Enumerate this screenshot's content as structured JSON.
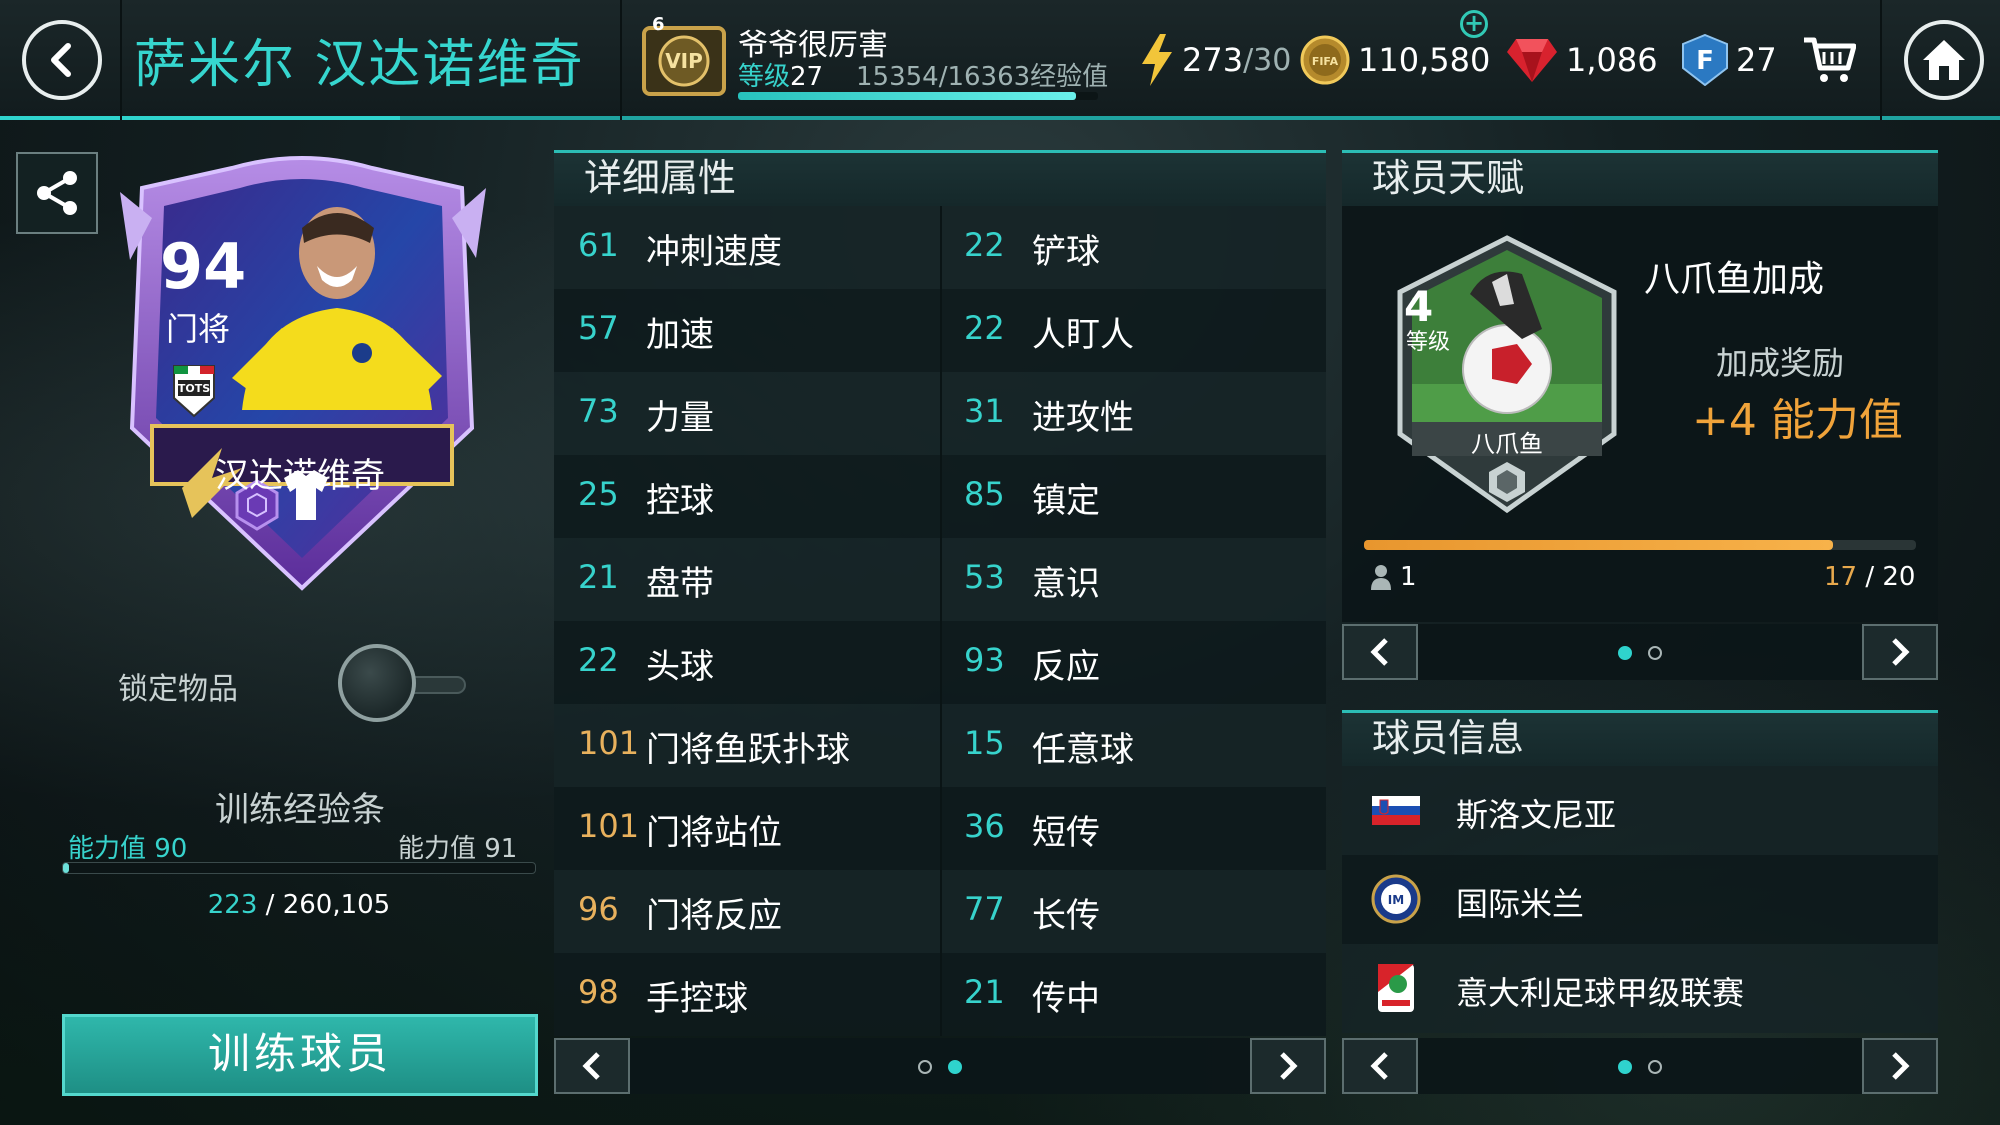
{
  "header": {
    "player_name": "萨米尔 汉达诺维奇",
    "vip": {
      "badge_level": "6",
      "username": "爷爷很厉害",
      "level_label": "等级",
      "level": "27",
      "xp": "15354/16363经验值",
      "xp_fraction": 0.938
    },
    "energy": {
      "current": "273",
      "max": "/30"
    },
    "coins": "110,580",
    "gems": "1,086",
    "fifa_points": "27"
  },
  "card": {
    "rating": "94",
    "position": "门将",
    "name": "汉达诺维奇",
    "event": "TOTS"
  },
  "lock": {
    "label": "锁定物品",
    "on": false
  },
  "training": {
    "title": "训练经验条",
    "left_label": "能力值 90",
    "right_label": "能力值 91",
    "current": "223",
    "separator": " / ",
    "total": "260,105",
    "fraction": 0.001,
    "button": "训练球员"
  },
  "attributes": {
    "title": "详细属性",
    "left": [
      {
        "value": "61",
        "name": "冲刺速度",
        "highlight": false
      },
      {
        "value": "57",
        "name": "加速",
        "highlight": false
      },
      {
        "value": "73",
        "name": "力量",
        "highlight": false
      },
      {
        "value": "25",
        "name": "控球",
        "highlight": false
      },
      {
        "value": "21",
        "name": "盘带",
        "highlight": false
      },
      {
        "value": "22",
        "name": "头球",
        "highlight": false
      },
      {
        "value": "101",
        "name": "门将鱼跃扑球",
        "highlight": true
      },
      {
        "value": "101",
        "name": "门将站位",
        "highlight": true
      },
      {
        "value": "96",
        "name": "门将反应",
        "highlight": true
      },
      {
        "value": "98",
        "name": "手控球",
        "highlight": true
      }
    ],
    "right": [
      {
        "value": "22",
        "name": "铲球",
        "highlight": false
      },
      {
        "value": "22",
        "name": "人盯人",
        "highlight": false
      },
      {
        "value": "31",
        "name": "进攻性",
        "highlight": false
      },
      {
        "value": "85",
        "name": "镇定",
        "highlight": false
      },
      {
        "value": "53",
        "name": "意识",
        "highlight": false
      },
      {
        "value": "93",
        "name": "反应",
        "highlight": false
      },
      {
        "value": "15",
        "name": "任意球",
        "highlight": false
      },
      {
        "value": "36",
        "name": "短传",
        "highlight": false
      },
      {
        "value": "77",
        "name": "长传",
        "highlight": false
      },
      {
        "value": "21",
        "name": "传中",
        "highlight": false
      }
    ],
    "page": 2,
    "pages": 2
  },
  "trait": {
    "title": "球员天赋",
    "level": "4",
    "level_label": "等级",
    "badge_name": "八爪鱼",
    "name": "八爪鱼加成",
    "bonus_label": "加成奖励",
    "bonus_value": "+4 能力值",
    "people_count": "1",
    "progress_current": "17",
    "progress_total": " / 20",
    "progress_fraction": 0.85,
    "page": 1,
    "pages": 2
  },
  "info": {
    "title": "球员信息",
    "rows": [
      {
        "icon": "slovenia-flag-icon",
        "text": "斯洛文尼亚"
      },
      {
        "icon": "inter-milan-crest-icon",
        "text": "国际米兰"
      },
      {
        "icon": "serie-a-logo-icon",
        "text": "意大利足球甲级联赛"
      }
    ],
    "page": 1,
    "pages": 2
  },
  "colors": {
    "accent": "#2fd3cd",
    "highlight": "#e8b15d",
    "bonus": "#f0a33a"
  }
}
